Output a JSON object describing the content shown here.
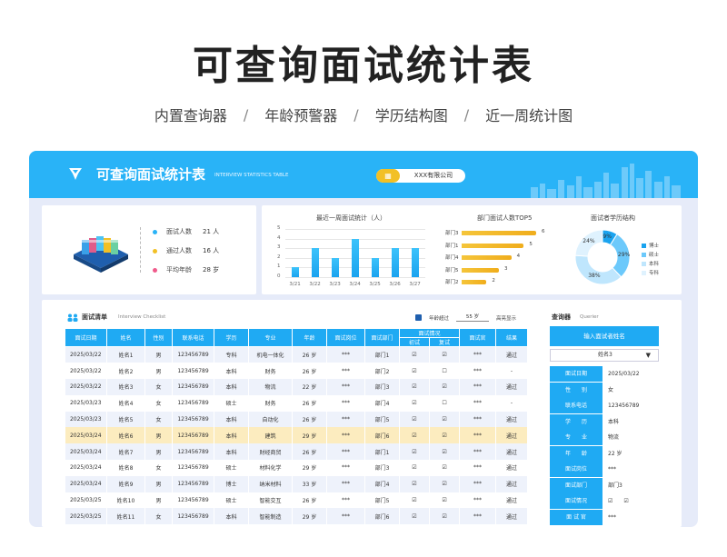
{
  "hero": {
    "title": "可查询面试统计表"
  },
  "subnav": {
    "items": [
      "内置查询器",
      "年龄预警器",
      "学历结构图",
      "近一周统计图"
    ],
    "sep": "/"
  },
  "banner": {
    "title": "可查询面试统计表",
    "subtitle": "INTERVIEW STATISTICS TABLE",
    "company": "XXX有限公司",
    "company_icon": "building-icon"
  },
  "stats": [
    {
      "label": "面试人数",
      "value": "21 人",
      "color": "#29b3f7"
    },
    {
      "label": "通过人数",
      "value": "16 人",
      "color": "#f2c025"
    },
    {
      "label": "平均年龄",
      "value": "28 岁",
      "color": "#f05a8b"
    }
  ],
  "chart_data": [
    {
      "type": "bar",
      "title": "最近一周面试统计（人）",
      "categories": [
        "3/21",
        "3/22",
        "3/23",
        "3/24",
        "3/25",
        "3/26",
        "3/27"
      ],
      "values": [
        1,
        3,
        2,
        4,
        2,
        3,
        3
      ],
      "ylim": [
        0,
        5
      ],
      "yticks": [
        "0",
        "1",
        "2",
        "3",
        "4",
        "5"
      ],
      "grid": true
    },
    {
      "type": "bar",
      "orientation": "horizontal",
      "title": "部门面试人数TOP5",
      "categories": [
        "部门3",
        "部门1",
        "部门4",
        "部门5",
        "部门2"
      ],
      "values": [
        6,
        5,
        4,
        3,
        2
      ]
    },
    {
      "type": "pie",
      "title": "面试者学历结构",
      "categories": [
        "博士",
        "硕士",
        "本科",
        "专科"
      ],
      "values": [
        9,
        29,
        38,
        24
      ],
      "labels": [
        "9%",
        "29%",
        "38%",
        "24%"
      ],
      "colors": [
        "#1aa3ef",
        "#6cc9fb",
        "#bfe6fd",
        "#dff2fe"
      ],
      "legend": "right"
    }
  ],
  "checklist": {
    "title": "面试清单",
    "subtitle": "Interview Checklist",
    "age_check_label": "年龄超过",
    "age_limit": "55 岁",
    "age_highlight": "高亮显示",
    "headers": [
      "面试日期",
      "姓名",
      "性别",
      "联系电话",
      "学历",
      "专业",
      "年龄",
      "面试岗位",
      "面试部门",
      "面试情况",
      "面试官",
      "结果"
    ],
    "sub_headers": [
      "初试",
      "复试"
    ],
    "rows": [
      [
        "2025/03/22",
        "姓名1",
        "男",
        "123456789",
        "专科",
        "机电一体化",
        "26 岁",
        "***",
        "部门1",
        "☑",
        "☑",
        "***",
        "通过"
      ],
      [
        "2025/03/22",
        "姓名2",
        "男",
        "123456789",
        "本科",
        "财务",
        "26 岁",
        "***",
        "部门2",
        "☑",
        "☐",
        "***",
        "-"
      ],
      [
        "2025/03/22",
        "姓名3",
        "女",
        "123456789",
        "本科",
        "物流",
        "22 岁",
        "***",
        "部门3",
        "☑",
        "☑",
        "***",
        "通过"
      ],
      [
        "2025/03/23",
        "姓名4",
        "女",
        "123456789",
        "硕士",
        "财务",
        "26 岁",
        "***",
        "部门4",
        "☑",
        "☐",
        "***",
        "-"
      ],
      [
        "2025/03/23",
        "姓名5",
        "女",
        "123456789",
        "本科",
        "自动化",
        "26 岁",
        "***",
        "部门5",
        "☑",
        "☑",
        "***",
        "通过"
      ],
      [
        "2025/03/24",
        "姓名6",
        "男",
        "123456789",
        "本科",
        "建筑",
        "29 岁",
        "***",
        "部门6",
        "☑",
        "☑",
        "***",
        "通过"
      ],
      [
        "2025/03/24",
        "姓名7",
        "男",
        "123456789",
        "本科",
        "财经商贸",
        "26 岁",
        "***",
        "部门1",
        "☑",
        "☑",
        "***",
        "通过"
      ],
      [
        "2025/03/24",
        "姓名8",
        "女",
        "123456789",
        "硕士",
        "材料化学",
        "29 岁",
        "***",
        "部门3",
        "☑",
        "☑",
        "***",
        "通过"
      ],
      [
        "2025/03/24",
        "姓名9",
        "男",
        "123456789",
        "博士",
        "纳米材料",
        "33 岁",
        "***",
        "部门4",
        "☑",
        "☑",
        "***",
        "通过"
      ],
      [
        "2025/03/25",
        "姓名10",
        "男",
        "123456789",
        "硕士",
        "智能交互",
        "26 岁",
        "***",
        "部门5",
        "☑",
        "☑",
        "***",
        "通过"
      ],
      [
        "2025/03/25",
        "姓名11",
        "女",
        "123456789",
        "本科",
        "智能制造",
        "29 岁",
        "***",
        "部门6",
        "☑",
        "☑",
        "***",
        "通过"
      ]
    ]
  },
  "querier": {
    "title": "查询器",
    "subtitle": "Querier",
    "prompt": "输入面试者姓名",
    "selected": "姓名3",
    "fields": [
      {
        "k": "面试日期",
        "v": "2025/03/22"
      },
      {
        "k": "性　　别",
        "v": "女"
      },
      {
        "k": "联系电话",
        "v": "123456789"
      },
      {
        "k": "学　　历",
        "v": "本科"
      },
      {
        "k": "专　　业",
        "v": "物流"
      },
      {
        "k": "年　　龄",
        "v": "22 岁"
      },
      {
        "k": "面试岗位",
        "v": "***"
      },
      {
        "k": "面试部门",
        "v": "部门3"
      },
      {
        "k": "面试情况",
        "v": "☑　　☑"
      },
      {
        "k": "面 试 官",
        "v": "***"
      }
    ]
  }
}
